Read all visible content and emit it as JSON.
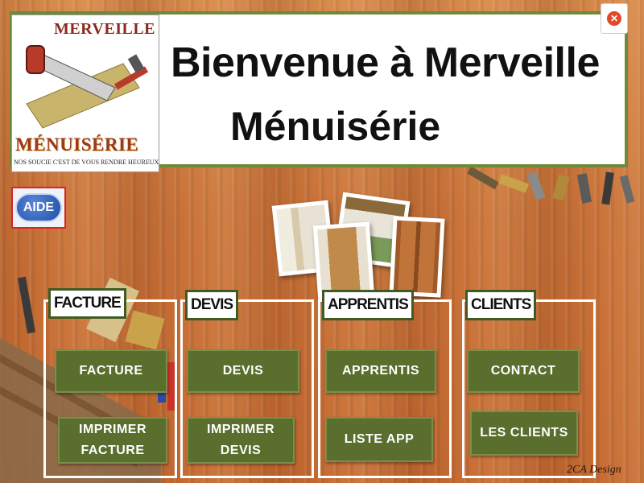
{
  "header": {
    "title_line1": "Bienvenue à Merveille",
    "title_line2": "Ménuisérie",
    "close_icon": "close-icon",
    "border_color": "#6d8a3a"
  },
  "logo": {
    "top_text": "MERVEILLE",
    "bottom_text": "MÉNUISÉRIE",
    "slogan": "NOS SOUCIE C'EST DE VOUS RENDRE HEUREUX"
  },
  "aide": {
    "label": "AIDE"
  },
  "sections": [
    {
      "tab": "FACTURE",
      "buttons": [
        "FACTURE",
        "IMPRIMER\nFACTURE"
      ]
    },
    {
      "tab": "DEVIS",
      "buttons": [
        "DEVIS",
        "IMPRIMER\nDEVIS"
      ]
    },
    {
      "tab": "APPRENTIS",
      "buttons": [
        "APPRENTIS",
        "LISTE APP"
      ]
    },
    {
      "tab": "CLIENTS",
      "buttons": [
        "CONTACT",
        "LES CLIENTS"
      ]
    }
  ],
  "footer": {
    "signature": "2CA Design"
  },
  "colors": {
    "button_bg": "#5a6e2e",
    "tab_border": "#3f5a22",
    "wood": "#c9733a"
  }
}
